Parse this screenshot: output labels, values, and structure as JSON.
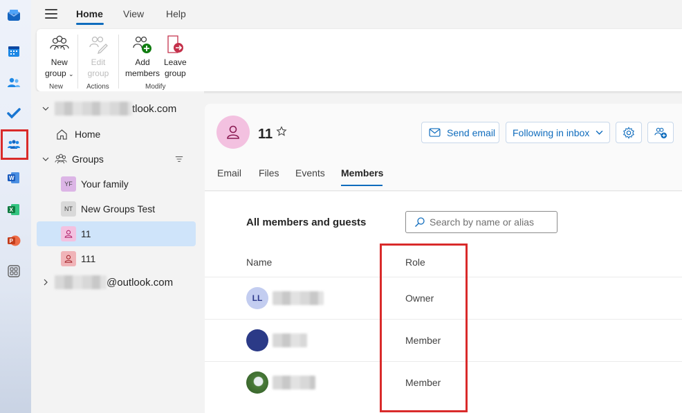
{
  "nav_tabs": [
    "Home",
    "View",
    "Help"
  ],
  "ribbon": {
    "new_group": {
      "line1": "New",
      "line2": "group"
    },
    "edit_group": {
      "line1": "Edit",
      "line2": "group"
    },
    "add_members": {
      "line1": "Add",
      "line2": "members"
    },
    "leave_group": {
      "line1": "Leave",
      "line2": "group"
    },
    "groups": {
      "new": "New",
      "actions": "Actions",
      "modify": "Modify"
    }
  },
  "folder_pane": {
    "account1_suffix": "tlook.com",
    "home": "Home",
    "groups_label": "Groups",
    "groups": [
      {
        "initials": "YF",
        "name": "Your family",
        "color": "#dcb5e6"
      },
      {
        "initials": "NT",
        "name": "New Groups Test",
        "color": "#d9d9d9"
      },
      {
        "initials": "",
        "name": "11",
        "color": "#f3c1e0"
      },
      {
        "initials": "",
        "name": "111",
        "color": "#f0b4b8"
      }
    ],
    "account2_suffix": "@outlook.com"
  },
  "group": {
    "title": "11",
    "send_email": "Send email",
    "following": "Following in inbox",
    "tabs": [
      "Email",
      "Files",
      "Events",
      "Members"
    ],
    "active_tab": "Members"
  },
  "members": {
    "section_title": "All members and guests",
    "search_placeholder": "Search by name or alias",
    "col_name": "Name",
    "col_role": "Role",
    "rows": [
      {
        "initials": "LL",
        "role": "Owner",
        "avatar_color": "#c3cdf0"
      },
      {
        "initials": "",
        "role": "Member",
        "avatar_color": "#2b3a87"
      },
      {
        "initials": "",
        "role": "Member",
        "avatar_color": "#4a7b3a"
      }
    ]
  },
  "colors": {
    "accent": "#0f6cbd",
    "highlight": "#d92a2a"
  }
}
